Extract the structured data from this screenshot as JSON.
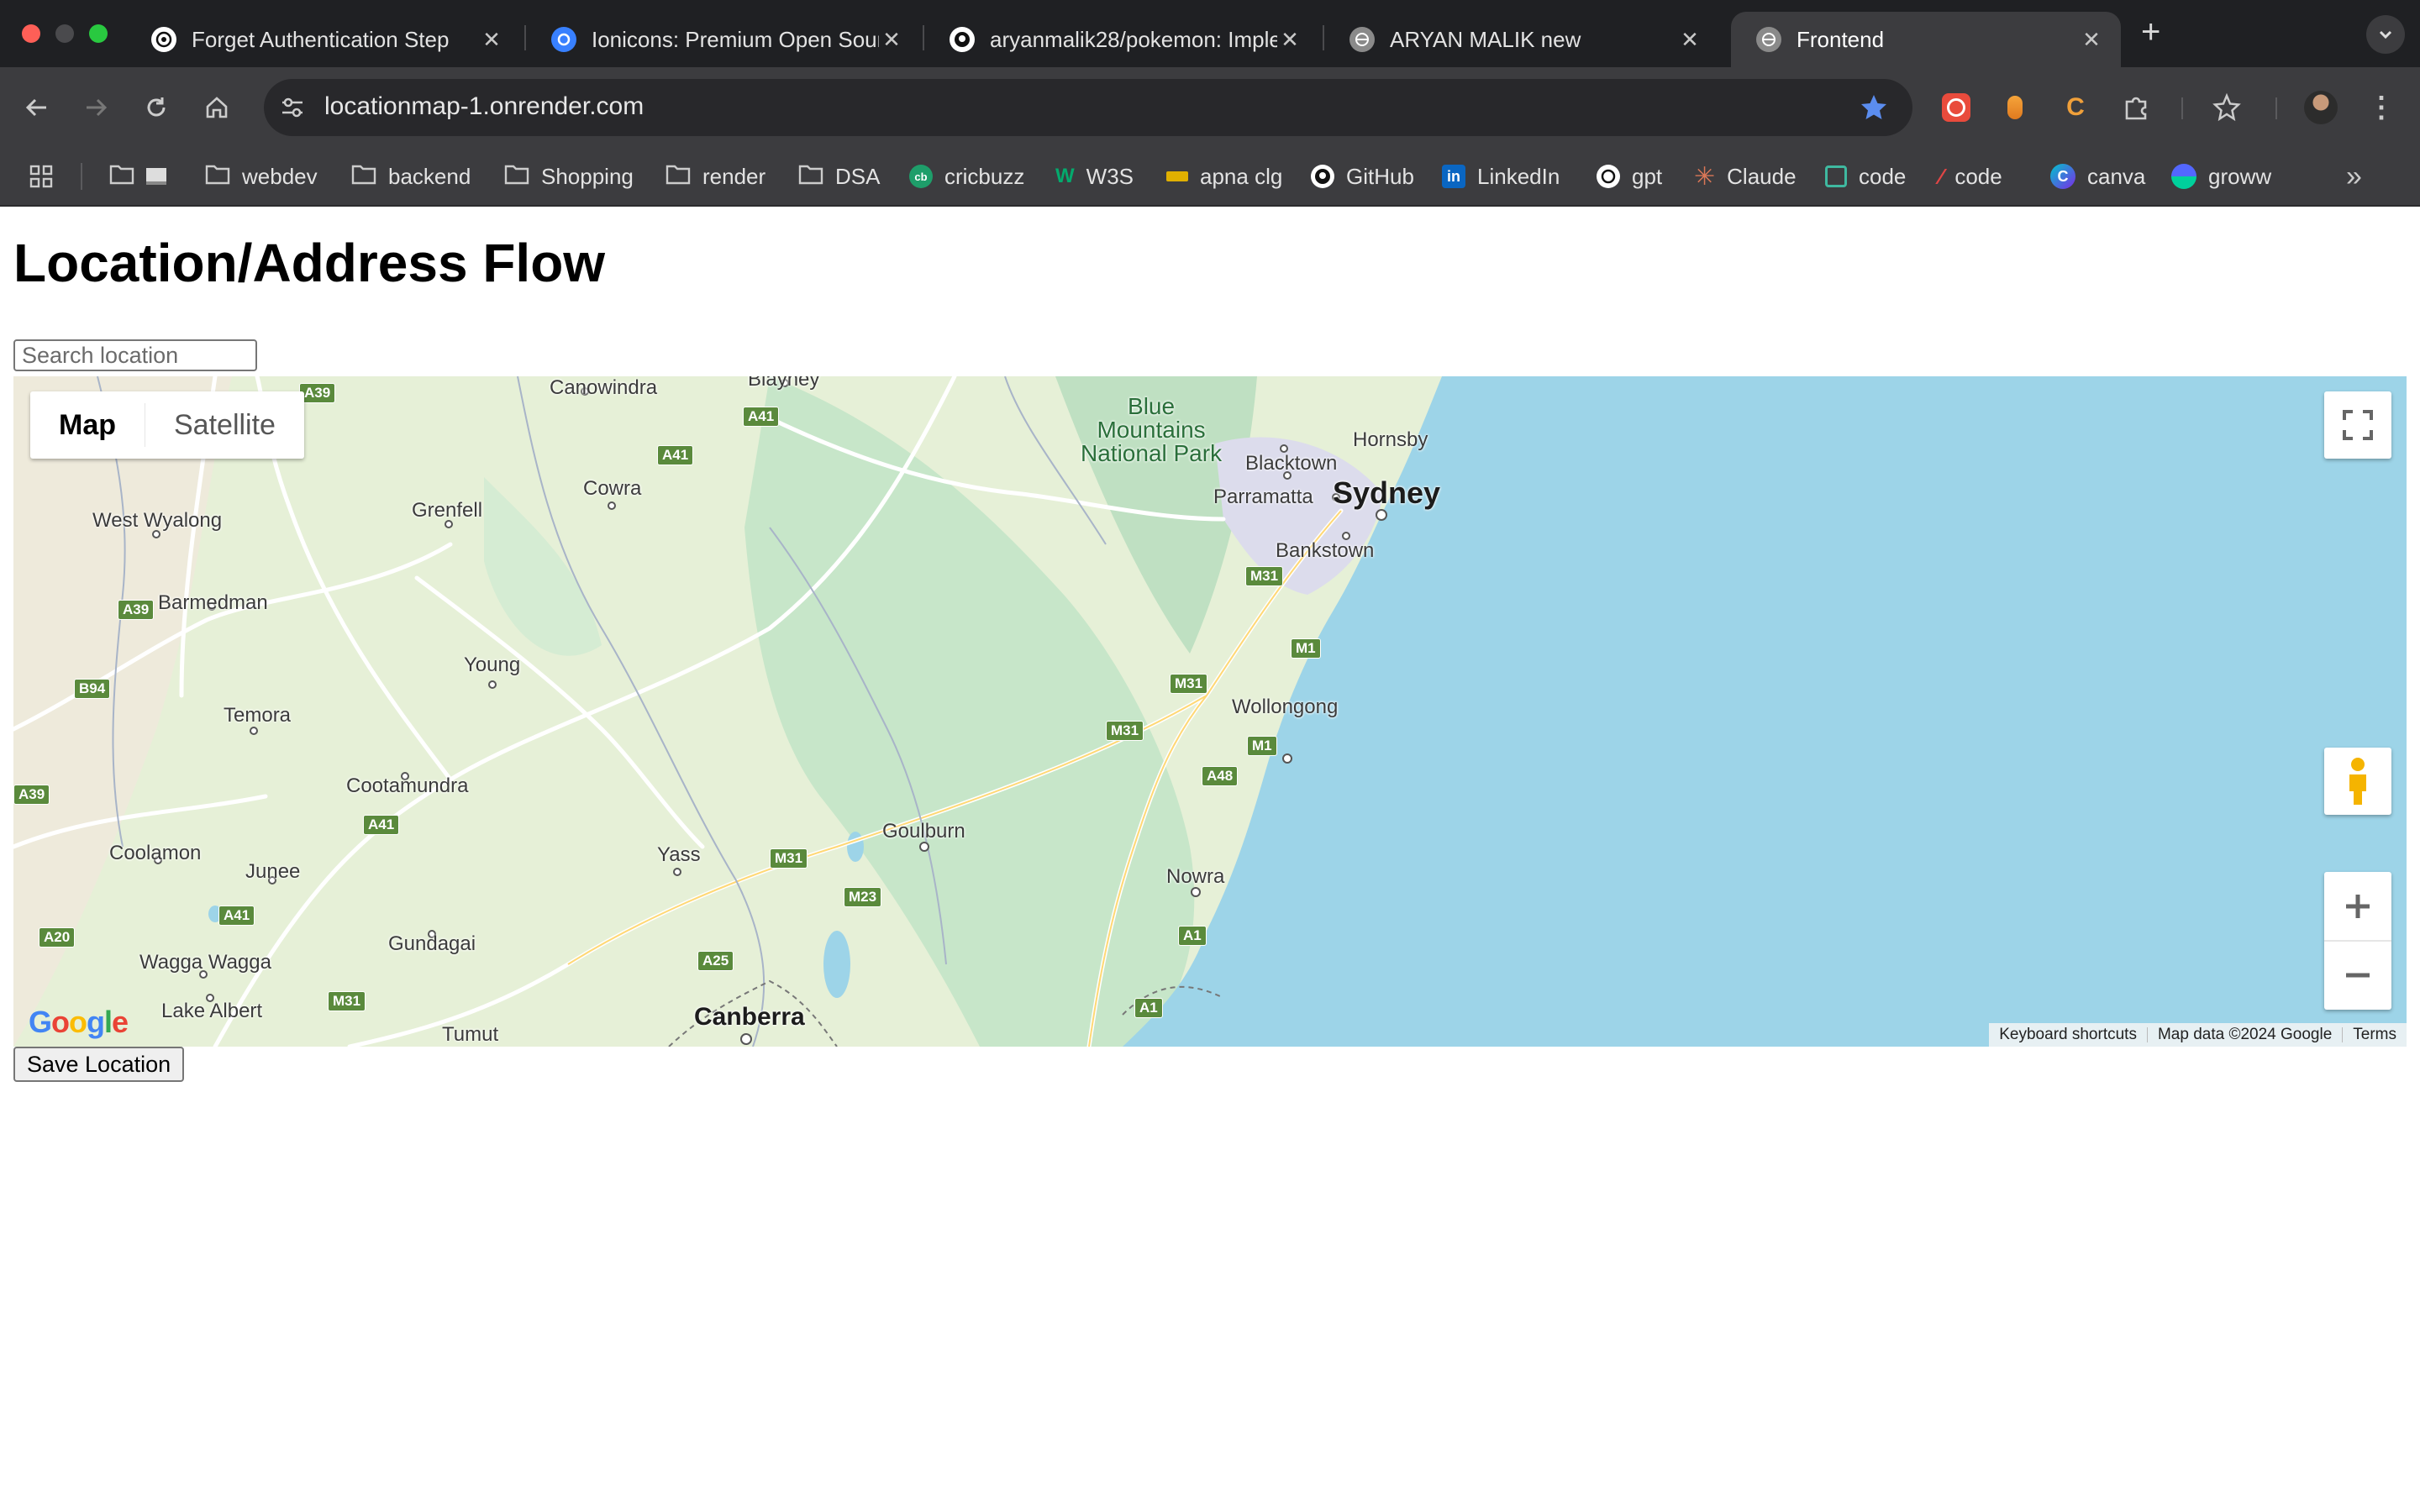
{
  "browser": {
    "tabs": [
      {
        "title": "Forget Authentication Step",
        "icon": "openai-icon"
      },
      {
        "title": "Ionicons: Premium Open Source",
        "icon": "ionicons-icon"
      },
      {
        "title": "aryanmalik28/pokemon: Imple",
        "icon": "github-icon"
      },
      {
        "title": "ARYAN MALIK new",
        "icon": "globe-icon"
      },
      {
        "title": "Frontend",
        "icon": "globe-icon",
        "active": true
      }
    ],
    "new_tab": "+",
    "url": "locationmap-1.onrender.com",
    "bookmarks": [
      {
        "label": "",
        "icon": "folder-icon"
      },
      {
        "label": "webdev",
        "icon": "folder-icon"
      },
      {
        "label": "backend",
        "icon": "folder-icon"
      },
      {
        "label": "Shopping",
        "icon": "folder-icon"
      },
      {
        "label": "render",
        "icon": "folder-icon"
      },
      {
        "label": "DSA",
        "icon": "folder-icon"
      },
      {
        "label": "cricbuzz",
        "icon": "cricbuzz-icon"
      },
      {
        "label": "W3S",
        "icon": "w3schools-icon"
      },
      {
        "label": "apna clg",
        "icon": "apnaclg-icon"
      },
      {
        "label": "GitHub",
        "icon": "github-icon"
      },
      {
        "label": "LinkedIn",
        "icon": "linkedin-icon"
      },
      {
        "label": "gpt",
        "icon": "openai-icon"
      },
      {
        "label": "Claude",
        "icon": "claude-icon"
      },
      {
        "label": "code",
        "icon": "code-icon"
      },
      {
        "label": "code",
        "icon": "code-icon"
      },
      {
        "label": "canva",
        "icon": "canva-icon"
      },
      {
        "label": "groww",
        "icon": "groww-icon"
      }
    ],
    "colors": {
      "chrome_dark": "#1f2023",
      "toolbar": "#3c3c3f",
      "star": "#5b8def"
    }
  },
  "page": {
    "title": "Location/Address Flow",
    "search_placeholder": "Search location",
    "save_label": "Save Location"
  },
  "map": {
    "type_buttons": {
      "map": "Map",
      "satellite": "Satellite"
    },
    "places": {
      "sydney": "Sydney",
      "hornsby": "Hornsby",
      "blacktown": "Blacktown",
      "parramatta": "Parramatta",
      "bankstown": "Bankstown",
      "wollongong": "Wollongong",
      "nowra": "Nowra",
      "goulburn": "Goulburn",
      "canberra": "Canberra",
      "yass": "Yass",
      "young": "Young",
      "cowra": "Cowra",
      "canowindra": "Canowindra",
      "blayney": "Blayney",
      "grenfell": "Grenfell",
      "west_wyalong": "West Wyalong",
      "barmedman": "Barmedman",
      "temora": "Temora",
      "cootamundra": "Cootamundra",
      "coolamon": "Coolamon",
      "junee": "Junee",
      "gundagai": "Gundagai",
      "wagga": "Wagga Wagga",
      "lake_albert": "Lake Albert",
      "tumut": "Tumut",
      "park": "Blue\nMountains\nNational Park"
    },
    "shields": {
      "a39a": "A39",
      "a39b": "A39",
      "a39c": "A39",
      "b94": "B94",
      "a41a": "A41",
      "a41b": "A41",
      "a41c": "A41",
      "a41d": "A41",
      "a20": "A20",
      "m31a": "M31",
      "m31b": "M31",
      "m31c": "M31",
      "m31d": "M31",
      "m31e": "M31",
      "m1a": "M1",
      "m1b": "M1",
      "a48": "A48",
      "m23": "M23",
      "a25": "A25",
      "a1a": "A1",
      "a1b": "A1"
    },
    "google_logo": "Google",
    "attribution": {
      "shortcuts": "Keyboard shortcuts",
      "data": "Map data ©2024 Google",
      "terms": "Terms"
    },
    "colors": {
      "land": "#e6f0d7",
      "forest": "#c5e4c6",
      "water": "#9dd4e8",
      "roads": "#ffffff"
    }
  }
}
